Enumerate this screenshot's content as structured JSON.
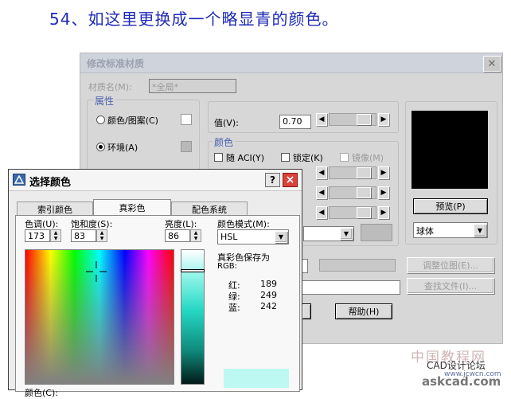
{
  "caption": "54、如这里更换成一个略显青的颜色。",
  "bg_dialog": {
    "title": "修改标准材质",
    "material_name_label": "材质名(M):",
    "material_name_value": "*全局*",
    "attributes_group": "属性",
    "radio_color_pattern": "颜色/图案(C)",
    "radio_ambient": "环境(A)",
    "value_label": "值(V):",
    "value_input": "0.70",
    "color_group": "颜色",
    "by_aci": "随 ACI(Y)",
    "lock": "锁定(K)",
    "mirror": "镜像(M)",
    "preview_button": "预览(P)",
    "preview_shape": "球体",
    "adjust_bitmap_button": "调整位图(E)...",
    "find_file_button": "查找文件(I)...",
    "help_button": "帮助(H)"
  },
  "fg_dialog": {
    "title": "选择颜色",
    "tabs": [
      "索引颜色",
      "真彩色",
      "配色系统"
    ],
    "active_tab": 1,
    "hue_label": "色调(U):",
    "hue_value": "173",
    "saturation_label": "饱和度(S):",
    "saturation_value": "83",
    "luminance_label": "亮度(L):",
    "luminance_value": "86",
    "color_model_label": "颜色模式(M):",
    "color_model_value": "HSL",
    "saved_as_label": "真彩色保存为",
    "saved_as_format": "RGB:",
    "rgb": [
      {
        "label": "红:",
        "value": "189"
      },
      {
        "label": "绿:",
        "value": "249"
      },
      {
        "label": "蓝:",
        "value": "242"
      }
    ],
    "bottom_color_label": "颜色(C):",
    "new_color": "#BDF9F2",
    "help_glyph": "?",
    "close_glyph": "×"
  },
  "watermark": {
    "line1": "中国教程网",
    "line2": "CAD设计论坛",
    "line3": "www.jcwcn.com",
    "line4": "askcad.com"
  },
  "colors": {
    "caption": "#1E2AB8",
    "bg_dialog": "#D7D7D7",
    "close_red": "#D9433A",
    "preview_black": "#000000",
    "selected_color": "#BDF9F2"
  }
}
